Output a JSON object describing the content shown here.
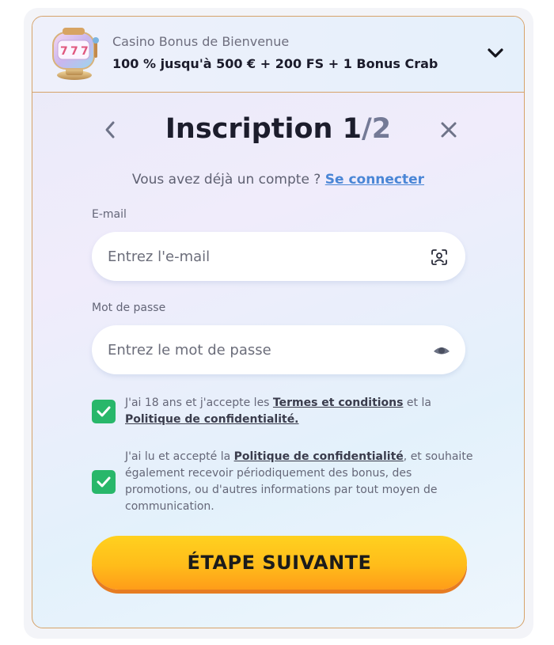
{
  "bonus": {
    "title": "Casino Bonus de Bienvenue",
    "offer": "100 % jusqu'à 500 € + 200 FS + 1 Bonus Crab"
  },
  "header": {
    "title": "Inscription",
    "step_current": "1",
    "step_total": "/2"
  },
  "login": {
    "prompt": "Vous avez déjà un compte ?",
    "link": "Se connecter"
  },
  "email": {
    "label": "E-mail",
    "placeholder": "Entrez l'e-mail",
    "value": ""
  },
  "password": {
    "label": "Mot de passe",
    "placeholder": "Entrez le mot de passe",
    "value": ""
  },
  "consent1": {
    "checked": true,
    "text_before": "J'ai 18 ans et j'accepte les ",
    "terms_link": "Termes et conditions",
    "text_middle": " et la ",
    "privacy_link": "Politique de confidentialité."
  },
  "consent2": {
    "checked": true,
    "text_before": "J'ai lu et accepté la ",
    "privacy_link": "Politique de confidentialité",
    "text_after": ", et souhaite également recevoir périodiquement des bonus, des promotions, ou d'autres informations par tout moyen de communication."
  },
  "next_button": {
    "label": "ÉTAPE SUIVANTE"
  },
  "colors": {
    "accent_orange": "#ffbc1a",
    "checkbox_green": "#28b76a",
    "link_blue": "#4a86d6"
  },
  "icons": {
    "bonus": "slot-machine-icon",
    "expand": "chevron-down-icon",
    "back": "chevron-left-icon",
    "close": "close-icon",
    "email_field": "contact-scan-icon",
    "password_field": "eye-icon",
    "checkbox": "checkmark-icon"
  }
}
